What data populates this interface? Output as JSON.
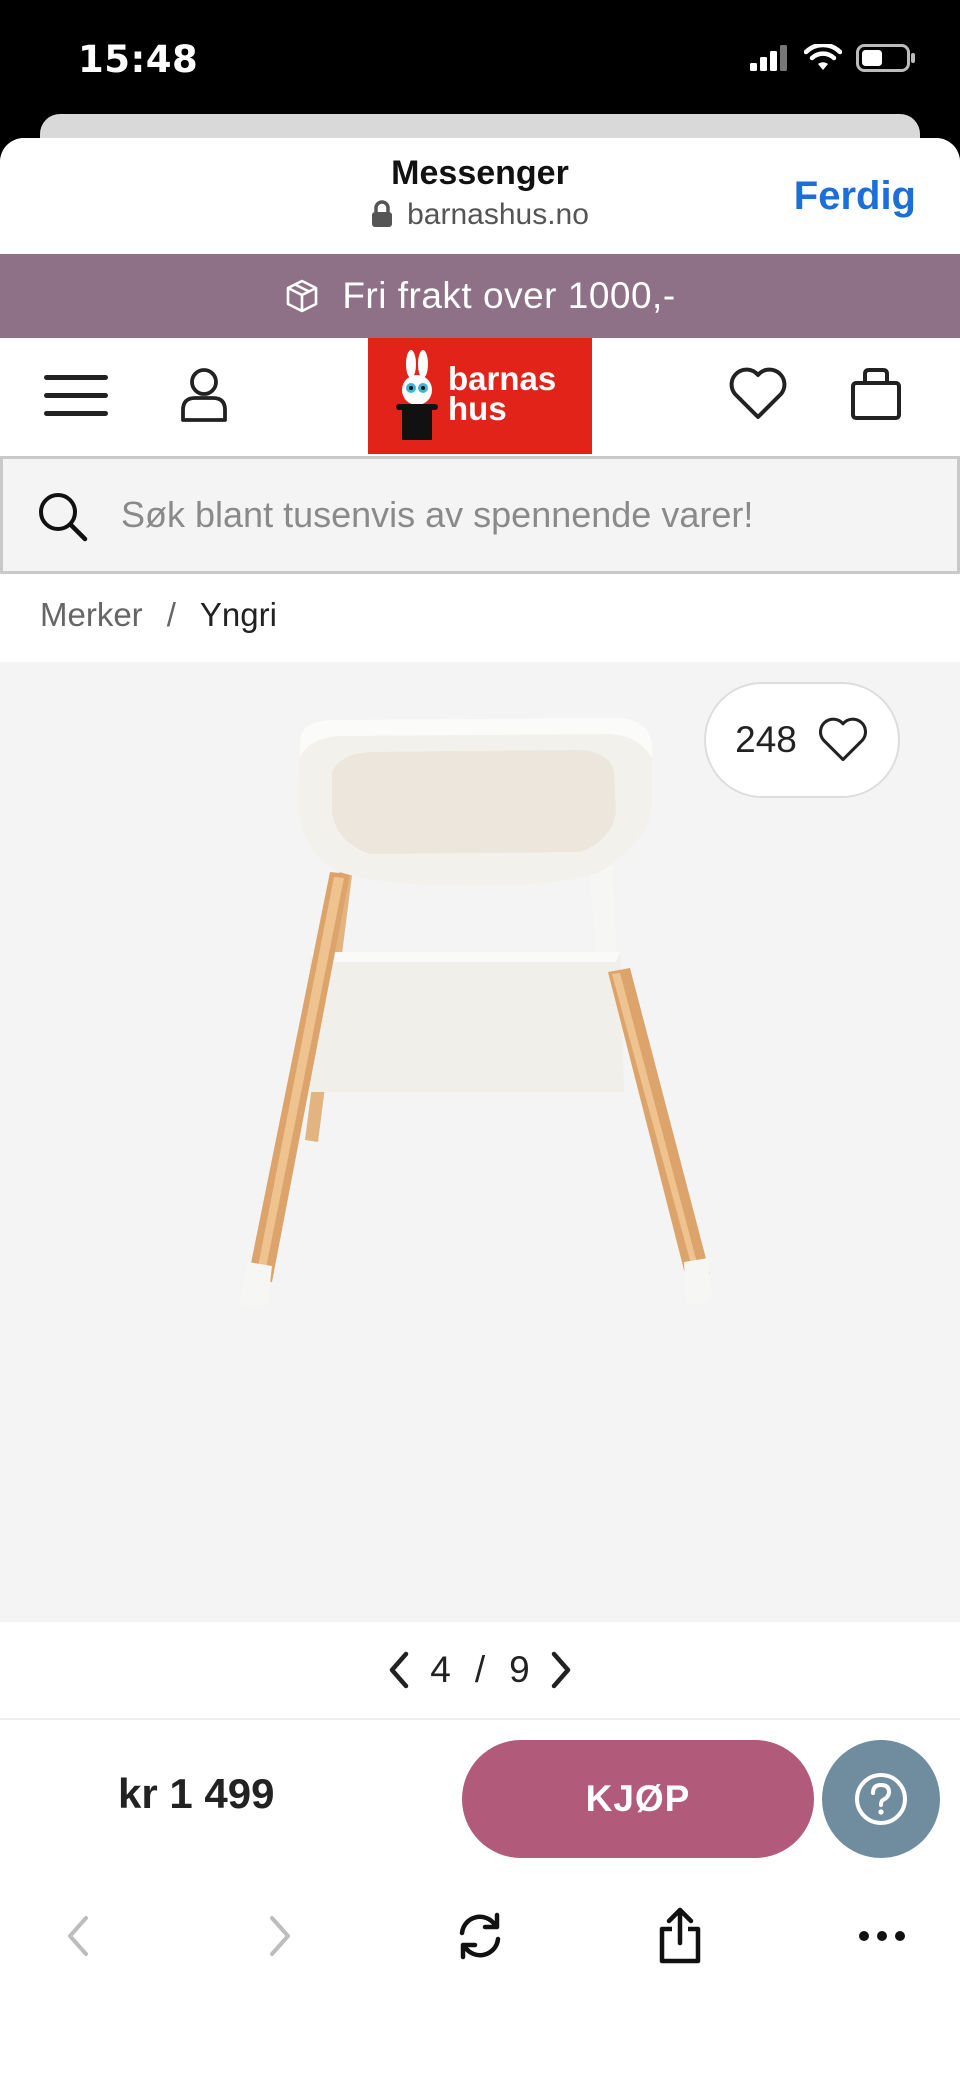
{
  "status": {
    "time": "15:48"
  },
  "browser": {
    "title": "Messenger",
    "url": "barnashus.no",
    "done_label": "Ferdig"
  },
  "promo": {
    "text": "Fri frakt over 1000,-"
  },
  "logo": {
    "line1": "barnas",
    "line2": "hus"
  },
  "search": {
    "placeholder": "Søk blant tusenvis av spennende varer!"
  },
  "breadcrumb": {
    "parent": "Merker",
    "separator": "/",
    "current": "Yngri"
  },
  "product": {
    "favorite_count": "248",
    "price": "kr 1 499",
    "buy_label": "KJØP"
  },
  "pager": {
    "current": "4",
    "separator": "/",
    "total": "9"
  },
  "colors": {
    "promo": "#8e7186",
    "logo": "#e2231a",
    "buy": "#b15a79",
    "help": "#6f8d9f",
    "link": "#1b6fd6"
  },
  "icons": [
    "menu-icon",
    "user-icon",
    "heart-icon",
    "bag-icon",
    "search-icon",
    "question-icon",
    "back-icon",
    "forward-icon",
    "reload-icon",
    "share-icon",
    "more-icon"
  ]
}
